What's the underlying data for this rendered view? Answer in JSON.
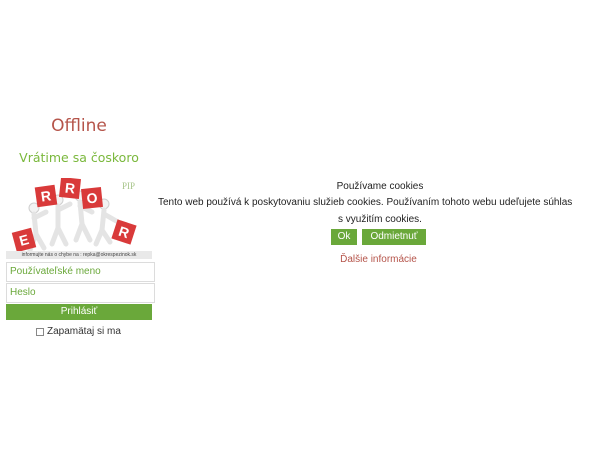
{
  "offline": {
    "title": "Offline",
    "subtitle": "Vrátime sa čoskoro",
    "logo_text": "ERROR",
    "logo_badge": "PIP",
    "contact": "informujte nás o chybe na : repka@okrespezinok.sk"
  },
  "login": {
    "username_placeholder": "Používateľské meno",
    "password_placeholder": "Heslo",
    "submit_label": "Prihlásiť",
    "remember_label": "Zapamätaj si ma"
  },
  "cookies": {
    "title": "Používame cookies",
    "text_line1": "Tento web používá k poskytovaniu služieb cookies. Používaním tohoto webu udeľujete súhlas",
    "text_line2": "s využitím cookies.",
    "ok_label": "Ok",
    "reject_label": "Odmietnuť",
    "more_label": "Ďalšie informácie"
  },
  "colors": {
    "accent_green": "#6aa83a",
    "accent_red": "#b5544a",
    "cube_red": "#d93a3a"
  }
}
